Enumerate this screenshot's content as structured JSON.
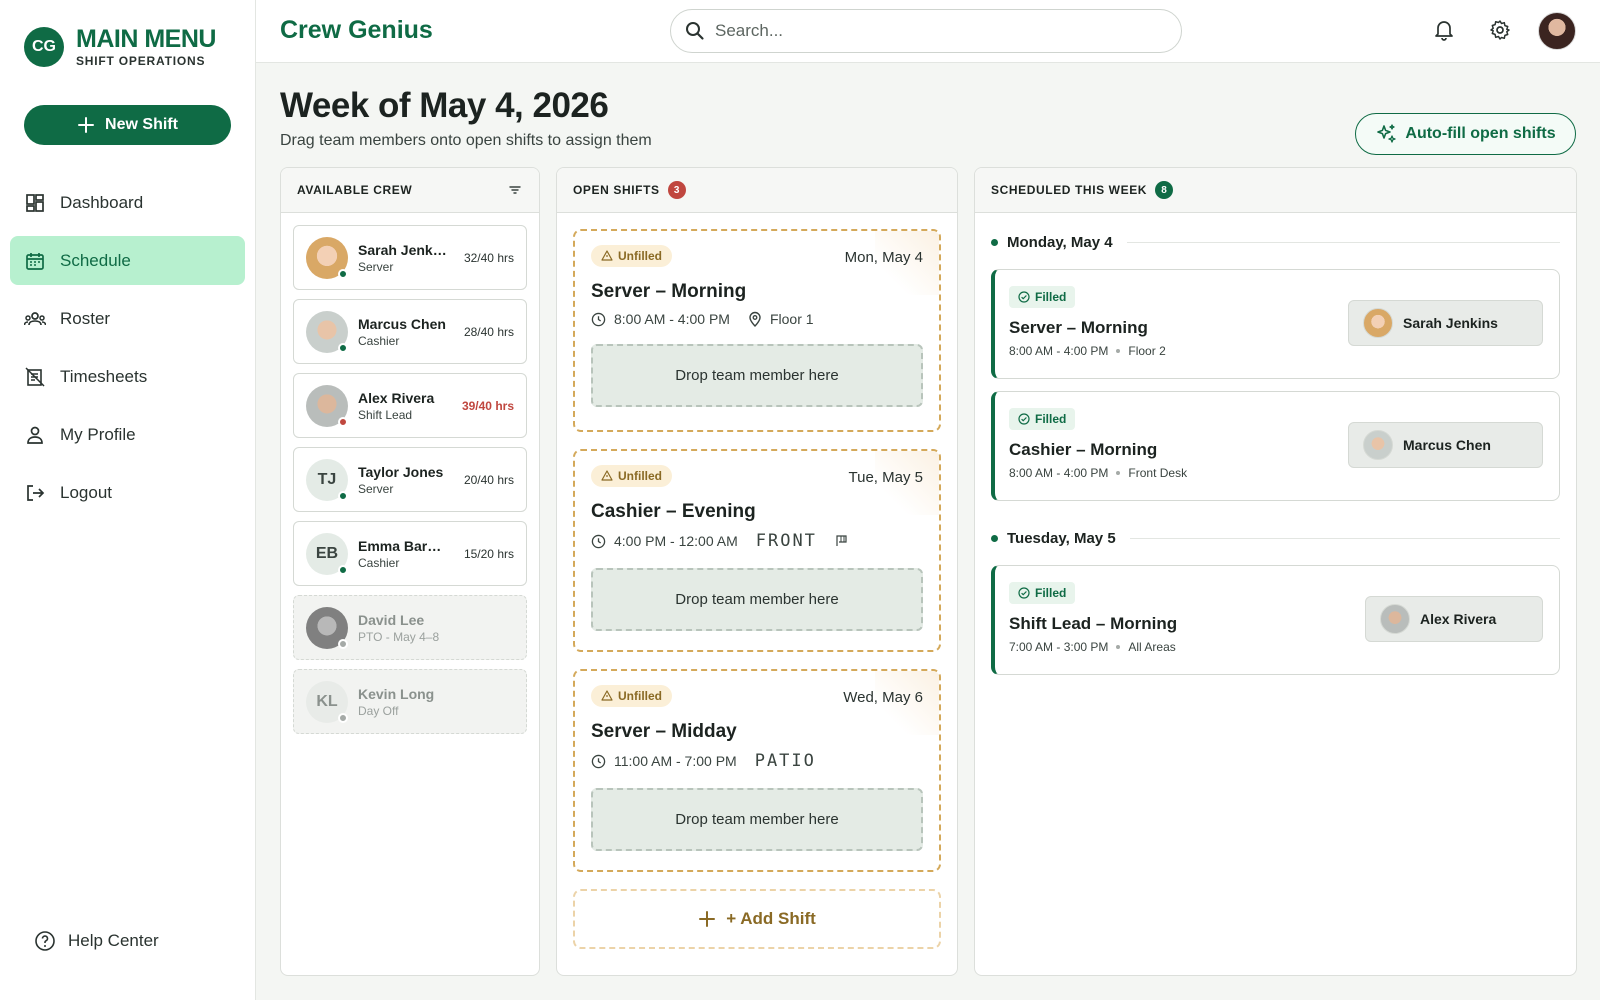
{
  "brand": {
    "logo": "CG",
    "title": "MAIN MENU",
    "subtitle": "SHIFT OPERATIONS"
  },
  "sidebar": {
    "new_shift_label": "New Shift",
    "items": [
      {
        "label": "Dashboard",
        "icon": "dashboard-icon",
        "active": false
      },
      {
        "label": "Schedule",
        "icon": "calendar-icon",
        "active": true
      },
      {
        "label": "Roster",
        "icon": "group-icon",
        "active": false
      },
      {
        "label": "Timesheets",
        "icon": "timesheet-icon",
        "active": false
      },
      {
        "label": "My Profile",
        "icon": "person-icon",
        "active": false
      },
      {
        "label": "Logout",
        "icon": "logout-icon",
        "active": false
      }
    ],
    "help_label": "Help Center"
  },
  "topbar": {
    "app_title": "Crew Genius",
    "search_placeholder": "Search..."
  },
  "page": {
    "title": "Week of May 4, 2026",
    "subtitle": "Drag team members onto open shifts to assign them",
    "autofill_label": "Auto-fill open shifts"
  },
  "crew": {
    "header": "AVAILABLE CREW",
    "members": [
      {
        "name": "Sarah Jenkins",
        "role": "Server",
        "hours": "32/40 hrs",
        "status": "available"
      },
      {
        "name": "Marcus Chen",
        "role": "Cashier",
        "hours": "28/40 hrs",
        "status": "available"
      },
      {
        "name": "Alex Rivera",
        "role": "Shift Lead",
        "hours": "39/40 hrs",
        "status": "near-limit"
      },
      {
        "name": "Taylor Jones",
        "initials": "TJ",
        "role": "Server",
        "hours": "20/40 hrs",
        "status": "available"
      },
      {
        "name": "Emma Barnes",
        "initials": "EB",
        "role": "Cashier",
        "hours": "15/20 hrs",
        "status": "available"
      },
      {
        "name": "David Lee",
        "role": "PTO - May 4–8",
        "status": "unavailable"
      },
      {
        "name": "Kevin Long",
        "initials": "KL",
        "role": "Day Off",
        "status": "unavailable"
      }
    ]
  },
  "open_shifts": {
    "header": "OPEN SHIFTS",
    "count": "3",
    "badge": "Unfilled",
    "drop_label": "Drop team member here",
    "add_label": "+ Add Shift",
    "shifts": [
      {
        "date": "Mon, May 4",
        "title": "Server – Morning",
        "time": "8:00 AM - 4:00 PM",
        "location": "Floor 1"
      },
      {
        "date": "Tue, May 5",
        "title": "Cashier – Evening",
        "time": "4:00 PM - 12:00 AM",
        "location": "FRONT"
      },
      {
        "date": "Wed, May 6",
        "title": "Server – Midday",
        "time": "11:00 AM - 7:00 PM",
        "location": "PATIO"
      }
    ]
  },
  "scheduled": {
    "header": "SCHEDULED THIS WEEK",
    "count": "8",
    "badge": "Filled",
    "days": [
      {
        "label": "Monday, May 4",
        "shifts": [
          {
            "title": "Server – Morning",
            "time": "8:00 AM - 4:00 PM",
            "location": "Floor 2",
            "assignee": "Sarah Jenkins"
          },
          {
            "title": "Cashier – Morning",
            "time": "8:00 AM - 4:00 PM",
            "location": "Front Desk",
            "assignee": "Marcus Chen"
          }
        ]
      },
      {
        "label": "Tuesday, May 5",
        "shifts": [
          {
            "title": "Shift Lead – Morning",
            "time": "7:00 AM - 3:00 PM",
            "location": "All Areas",
            "assignee": "Alex Rivera"
          }
        ]
      }
    ]
  },
  "colors": {
    "brand": "#0f6b45",
    "active_nav": "#b7f0cf",
    "warning": "#d4a95a",
    "danger": "#c0473f"
  }
}
